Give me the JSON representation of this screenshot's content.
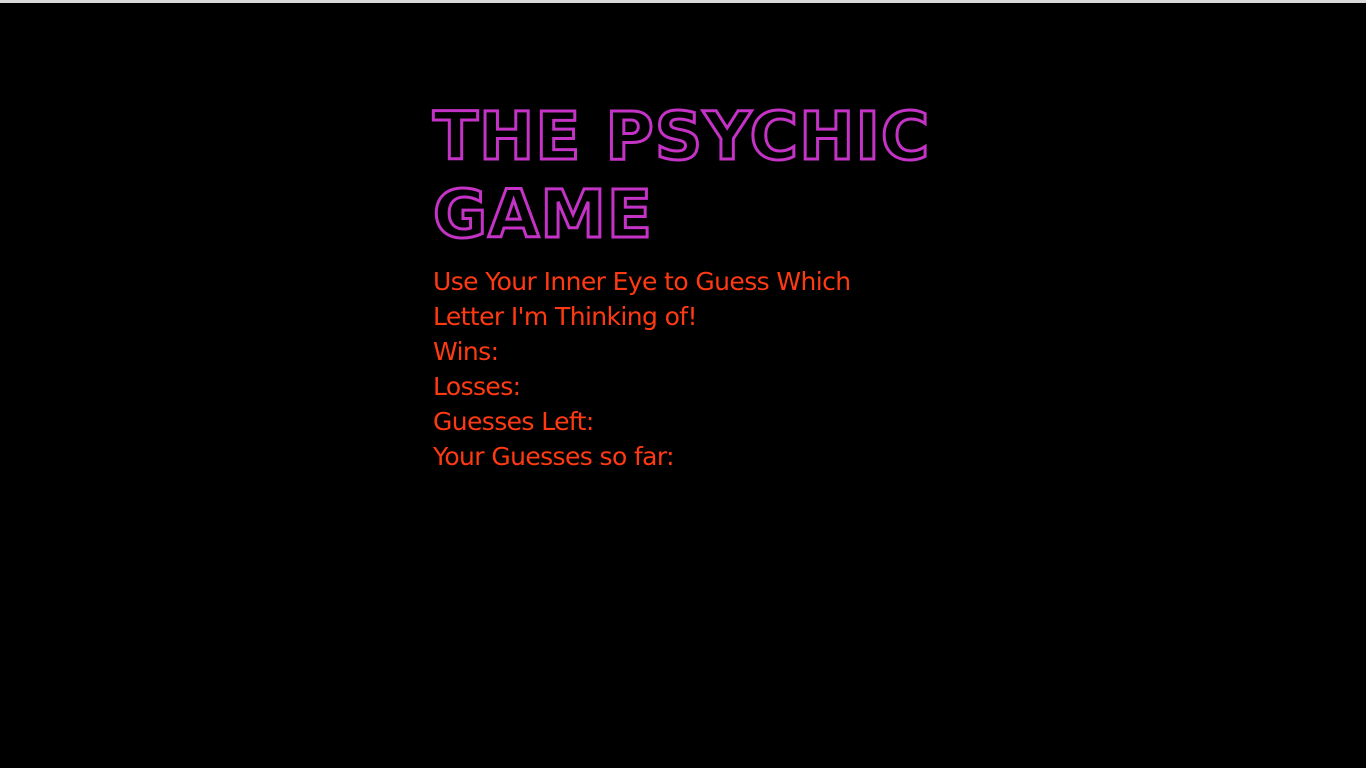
{
  "page": {
    "background_color": "#000000",
    "title_color": "#c433c6",
    "text_color": "#ff3a12"
  },
  "game": {
    "title_line_1": "The Psychic",
    "title_line_2": "Game",
    "subtitle": "Use Your Inner Eye to Guess Which Letter I'm Thinking of!",
    "stats": {
      "wins_label": "Wins:",
      "wins_value": "",
      "losses_label": "Losses:",
      "losses_value": "",
      "guesses_left_label": "Guesses Left:",
      "guesses_left_value": "",
      "guesses_so_far_label": "Your Guesses so far:",
      "guesses_so_far_value": ""
    }
  }
}
